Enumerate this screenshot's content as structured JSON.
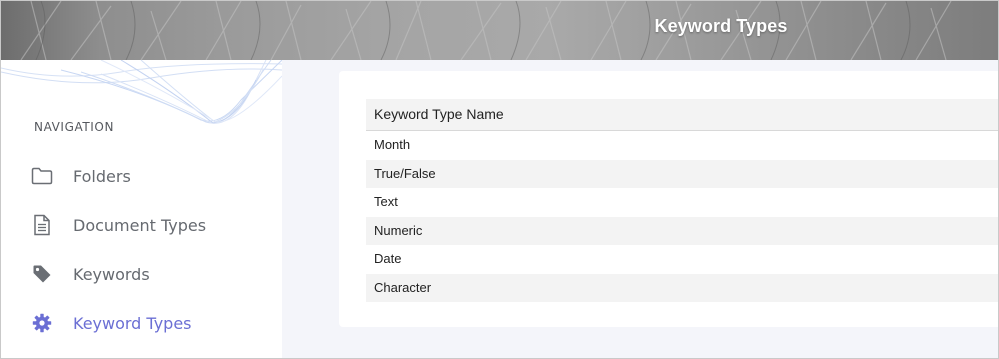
{
  "header": {
    "title": "Keyword Types"
  },
  "sidebar": {
    "heading": "NAVIGATION",
    "items": [
      {
        "label": "Folders",
        "icon": "folder-icon",
        "active": false
      },
      {
        "label": "Document Types",
        "icon": "document-icon",
        "active": false
      },
      {
        "label": "Keywords",
        "icon": "tag-icon",
        "active": false
      },
      {
        "label": "Keyword Types",
        "icon": "gear-icon",
        "active": true
      }
    ]
  },
  "table": {
    "column_header": "Keyword Type Name",
    "rows": [
      "Month",
      "True/False",
      "Text",
      "Numeric",
      "Date",
      "Character"
    ]
  },
  "colors": {
    "accent": "#6b6fd4",
    "nav_text": "#666a70",
    "background": "#f4f5fa",
    "row_shade": "#f3f3f3"
  }
}
